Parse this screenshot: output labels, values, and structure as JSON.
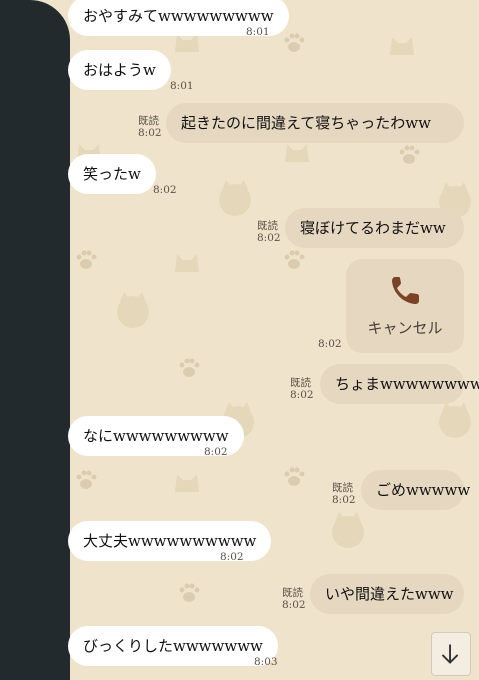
{
  "messages": [
    {
      "side": "in",
      "text": "おやすみてwwwwwwwww",
      "time": "8:01"
    },
    {
      "side": "in",
      "text": "おはようw",
      "time": "8:01"
    },
    {
      "side": "out",
      "text": "起きたのに間違えて寝ちゃったわww",
      "read": "既読",
      "time": "8:02"
    },
    {
      "side": "in",
      "text": "笑ったw",
      "time": "8:02"
    },
    {
      "side": "out",
      "text": "寝ぼけてるわまだww",
      "read": "既読",
      "time": "8:02"
    },
    {
      "side": "in",
      "text": "なにwwwwwwwww",
      "time": "8:02"
    },
    {
      "side": "out",
      "text": "ちょまwwwwwwwww",
      "read": "既読",
      "time": "8:02"
    },
    {
      "side": "out",
      "text": "ごめwwwww",
      "read": "既読",
      "time": "8:02"
    },
    {
      "side": "in",
      "text": "大丈夫wwwwwwwwww",
      "time": "8:02"
    },
    {
      "side": "out",
      "text": "いや間違えたwww",
      "read": "既読",
      "time": "8:02"
    },
    {
      "side": "in",
      "text": "びっくりしたwwwwwww",
      "time": "8:03"
    }
  ],
  "call": {
    "label": "キャンセル",
    "time": "8:02",
    "icon": "phone-icon"
  },
  "scroll_button": {
    "icon": "arrow-down-icon"
  },
  "colors": {
    "background": "#efe4cb",
    "incoming": "#ffffff",
    "outgoing": "#e6d8c0",
    "panel": "#232a2d"
  }
}
